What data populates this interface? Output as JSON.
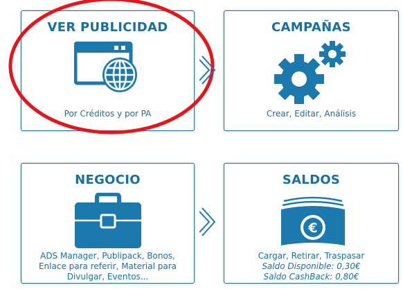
{
  "colors": {
    "accent": "#1a6fa0",
    "icon": "#1b79ad",
    "highlight": "#e8141b"
  },
  "cards": {
    "ver_publicidad": {
      "title": "VER PUBLICIDAD",
      "subtitle": "Por Créditos y por PA",
      "icon": "browser-globe-icon"
    },
    "campanas": {
      "title": "CAMPAÑAS",
      "subtitle": "Crear, Editar, Análisis",
      "icon": "gears-icon"
    },
    "negocio": {
      "title": "NEGOCIO",
      "subtitle_lines": [
        "ADS Manager, Publipack, Bonos,",
        "Enlace para referir, Material para",
        "Divulgar, Eventos..."
      ],
      "icon": "briefcase-icon"
    },
    "saldos": {
      "title": "SALDOS",
      "subtitle": "Cargar, Retirar, Traspasar",
      "saldo_disponible": "Saldo Disponible: 0,30€",
      "saldo_cashback": "Saldo CashBack: 0,80€",
      "icon": "euro-wallet-icon"
    }
  },
  "arrows": [
    "chevron-right-icon",
    "chevron-right-icon"
  ]
}
